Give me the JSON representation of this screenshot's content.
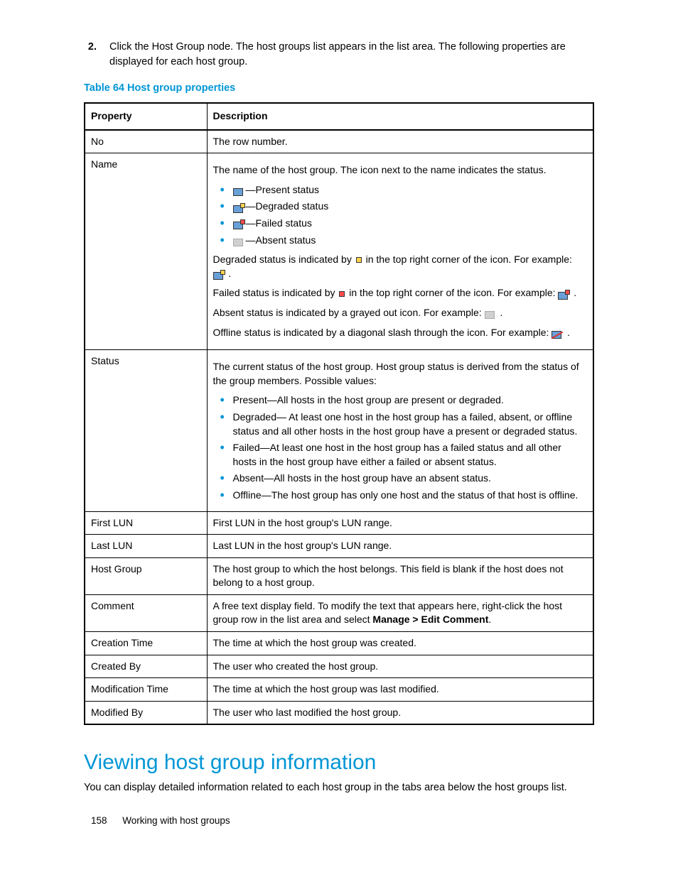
{
  "step": {
    "number": "2.",
    "text": "Click the Host Group node. The host groups list appears in the list area. The following properties are displayed for each host group."
  },
  "table": {
    "title": "Table 64 Host group properties",
    "headers": {
      "property": "Property",
      "description": "Description"
    },
    "rows": {
      "no": {
        "prop": "No",
        "desc": "The row number."
      },
      "name": {
        "prop": "Name",
        "line1": "The name of the host group. The icon next to the name indicates the status.",
        "b0": "—Present status",
        "b1": "—Degraded status",
        "b2": "—Failed status",
        "b3": "—Absent status",
        "p1a": "Degraded status is indicated by ",
        "p1b": " in the top right corner of the icon. For example: ",
        "p1c": " .",
        "p2a": "Failed status is indicated by ",
        "p2b": " in the top right corner of the icon. For example: ",
        "p2c": " .",
        "p3a": "Absent status is indicated by a grayed out icon. For example: ",
        "p3b": " .",
        "p4a": "Offline status is indicated by a diagonal slash through the icon. For example: ",
        "p4b": " ."
      },
      "status": {
        "prop": "Status",
        "line1": "The current status of the host group. Host group status is derived from the status of the group members. Possible values:",
        "b0": "Present—All hosts in the host group are present or degraded.",
        "b1": "Degraded— At least one host in the host group has a failed, absent, or offline status and all other hosts in the host group have a present or degraded status.",
        "b2": "Failed—At least one host in the host group has a failed status and all other hosts in the host group have either a failed or absent status.",
        "b3": "Absent—All hosts in the host group have an absent status.",
        "b4": "Offline—The host group has only one host and the status of that host is offline."
      },
      "firstlun": {
        "prop": "First LUN",
        "desc": "First LUN in the host group's LUN range."
      },
      "lastlun": {
        "prop": "Last LUN",
        "desc": "Last LUN in the host group's LUN range."
      },
      "hostgroup": {
        "prop": "Host Group",
        "desc": "The host group to which the host belongs. This field is blank if the host does not belong to a host group."
      },
      "comment": {
        "prop": "Comment",
        "a": "A free text display field. To modify the text that appears here, right-click the host group row in the list area and select ",
        "b": "Manage > Edit Comment",
        "c": "."
      },
      "ctime": {
        "prop": "Creation Time",
        "desc": "The time at which the host group was created."
      },
      "cby": {
        "prop": "Created By",
        "desc": "The user who created the host group."
      },
      "mtime": {
        "prop": "Modification Time",
        "desc": "The time at which the host group was last modified."
      },
      "mby": {
        "prop": "Modified By",
        "desc": "The user who last modified the host group."
      }
    }
  },
  "section": {
    "heading": "Viewing host group information",
    "body": "You can display detailed information related to each host group in the tabs area below the host groups list."
  },
  "footer": {
    "page": "158",
    "chapter": "Working with host groups"
  }
}
